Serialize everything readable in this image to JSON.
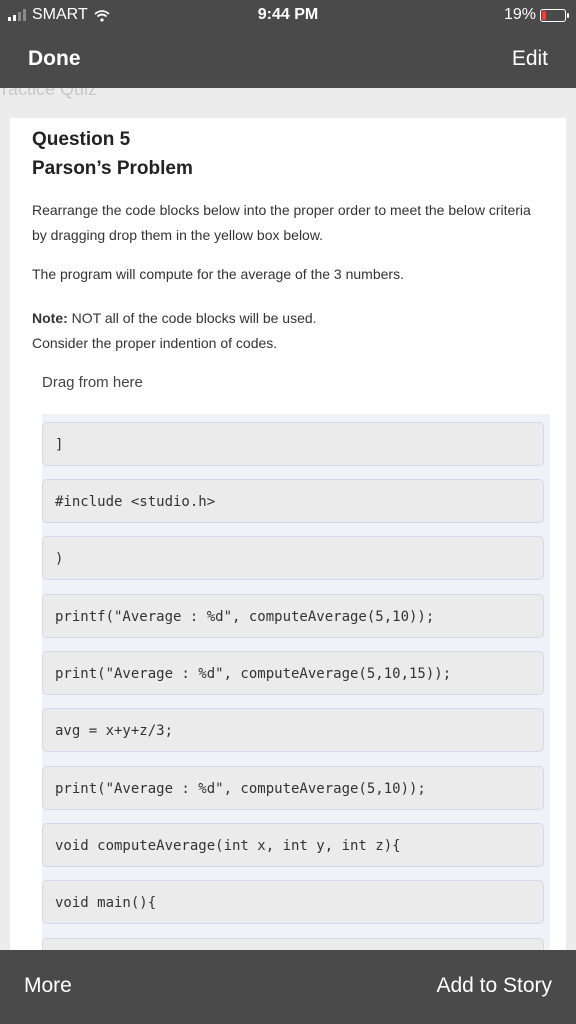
{
  "status": {
    "carrier": "SMART",
    "time": "9:44 PM",
    "battery": "19%",
    "battery_level": 0.19,
    "battery_color": "#ff3b30"
  },
  "nav": {
    "done": "Done",
    "edit": "Edit"
  },
  "page": {
    "cut_title": "ractice Quiz"
  },
  "question": {
    "title": "Question 5",
    "subtitle": "Parson’s Problem",
    "instructions": "Rearrange the code blocks below into the proper order to meet the below criteria by dragging drop them in the yellow box below.",
    "task": "The program will compute for the average of the 3 numbers.",
    "note_label": "Note:",
    "note_text": " NOT all of the code blocks will be used.",
    "indent_text": "Consider the proper indention of codes."
  },
  "drag_label": "Drag from here",
  "blocks": [
    "]",
    "#include <studio.h>",
    ")",
    "printf(\"Average : %d\", computeAverage(5,10));",
    "print(\"Average : %d\", computeAverage(5,10,15));",
    "avg = x+y+z/3;",
    "print(\"Average : %d\", computeAverage(5,10));",
    "void computeAverage(int x, int y, int z){",
    "void main(){",
    ""
  ],
  "bottom": {
    "more": "More",
    "add_to_story": "Add to Story"
  }
}
